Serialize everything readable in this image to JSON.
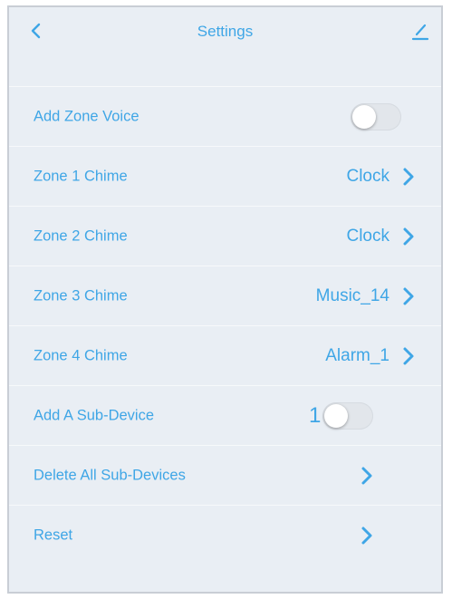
{
  "header": {
    "title": "Settings",
    "back_icon": "chevron-left-icon",
    "edit_icon": "edit-icon"
  },
  "rows": [
    {
      "label": "Add Zone Voice",
      "type": "toggle",
      "on": false
    },
    {
      "label": "Zone 1 Chime",
      "type": "value",
      "value": "Clock"
    },
    {
      "label": "Zone 2 Chime",
      "type": "value",
      "value": "Clock"
    },
    {
      "label": "Zone 3 Chime",
      "type": "value",
      "value": "Music_14"
    },
    {
      "label": "Zone 4 Chime",
      "type": "value",
      "value": "Alarm_1"
    },
    {
      "label": "Add A Sub-Device",
      "type": "toggle",
      "on": false,
      "count": "1"
    },
    {
      "label": "Delete All Sub-Devices",
      "type": "link"
    },
    {
      "label": "Reset",
      "type": "link"
    }
  ],
  "colors": {
    "accent": "#3fa6e6",
    "background": "#e9eef4"
  }
}
